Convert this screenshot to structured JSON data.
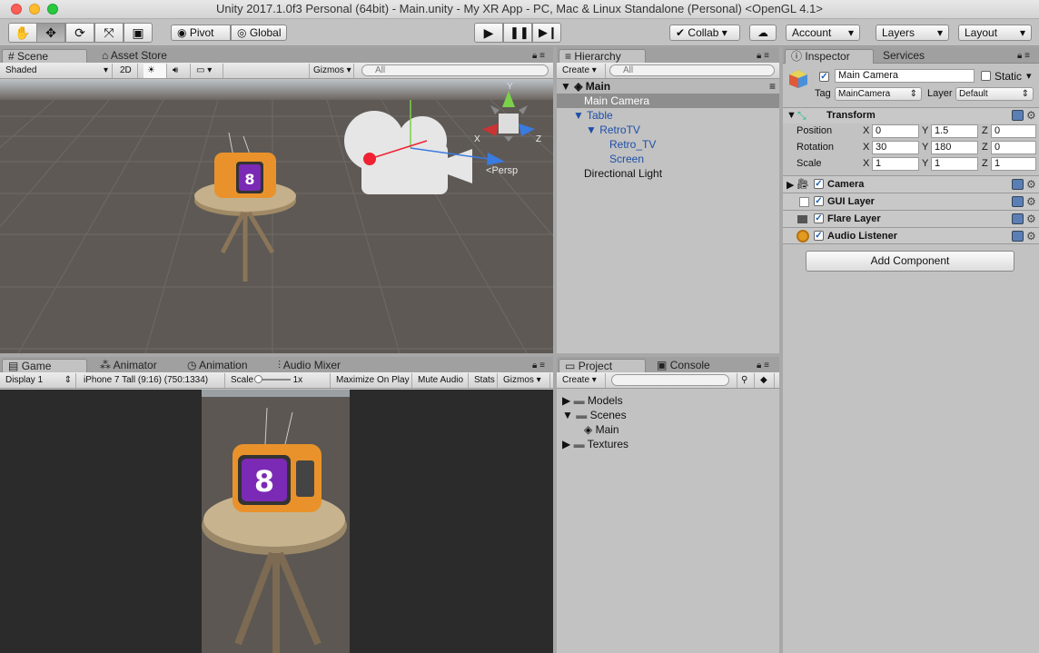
{
  "window": {
    "title": "Unity 2017.1.0f3 Personal (64bit) - Main.unity - My XR App - PC, Mac & Linux Standalone (Personal) <OpenGL 4.1>"
  },
  "toolbar": {
    "pivot": "Pivot",
    "global": "Global",
    "collab": "Collab ▾",
    "account": "Account",
    "layers": "Layers",
    "layout": "Layout"
  },
  "scene": {
    "tabs": [
      "Scene",
      "Asset Store"
    ],
    "shaded": "Shaded",
    "mode_2d": "2D",
    "gizmos": "Gizmos",
    "search_placeholder": "All",
    "persp": "Persp",
    "axis_x": "X",
    "axis_y": "Y",
    "axis_z": "Z"
  },
  "game": {
    "tabs": [
      "Game",
      "Animator",
      "Animation",
      "Audio Mixer"
    ],
    "display": "Display 1",
    "resolution": "iPhone 7 Tall (9:16) (750:1334)",
    "scale_label": "Scale",
    "scale_value": "1x",
    "maximize": "Maximize On Play",
    "mute": "Mute Audio",
    "stats": "Stats",
    "gizmos": "Gizmos"
  },
  "hierarchy": {
    "tab": "Hierarchy",
    "create": "Create",
    "search_placeholder": "All",
    "scene_name": "Main",
    "items": [
      "Main Camera",
      "Table",
      "RetroTV",
      "Retro_TV",
      "Screen",
      "Directional Light"
    ]
  },
  "project": {
    "tabs": [
      "Project",
      "Console"
    ],
    "create": "Create",
    "folders": [
      "Models",
      "Scenes",
      "Main",
      "Textures"
    ]
  },
  "inspector": {
    "tabs": [
      "Inspector",
      "Services"
    ],
    "object_name": "Main Camera",
    "static_label": "Static",
    "tag_label": "Tag",
    "tag_value": "MainCamera",
    "layer_label": "Layer",
    "layer_value": "Default",
    "transform": {
      "title": "Transform",
      "rows": [
        {
          "label": "Position",
          "x": "0",
          "y": "1.5",
          "z": "0"
        },
        {
          "label": "Rotation",
          "x": "30",
          "y": "180",
          "z": "0"
        },
        {
          "label": "Scale",
          "x": "1",
          "y": "1",
          "z": "1"
        }
      ]
    },
    "components": [
      "Camera",
      "GUI Layer",
      "Flare Layer",
      "Audio Listener"
    ],
    "add_component": "Add Component"
  }
}
